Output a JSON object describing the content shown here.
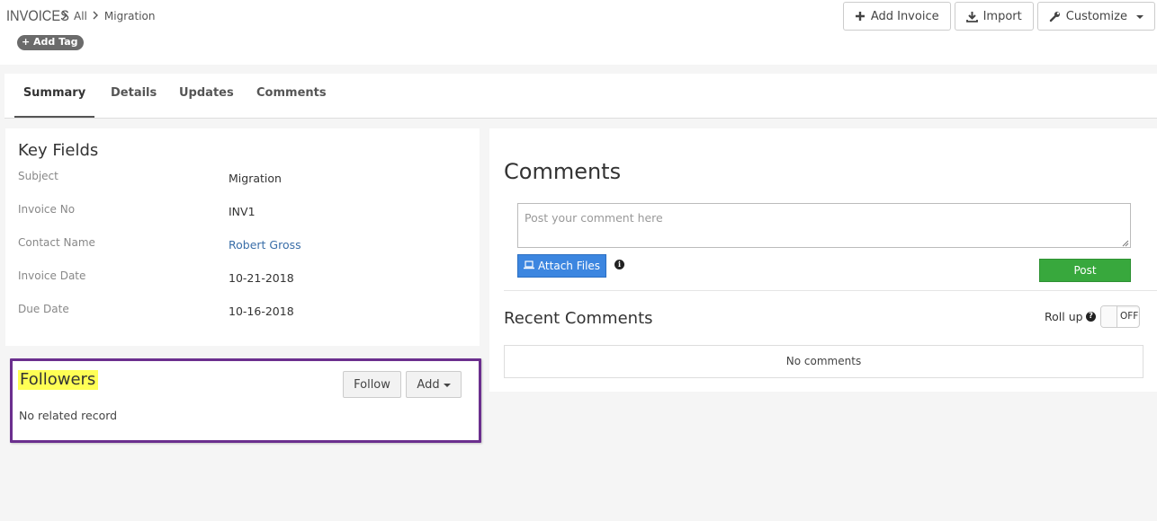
{
  "header": {
    "module": "INVOICES",
    "breadcrumb": [
      "All",
      "Migration"
    ],
    "add_tag_label": "+ Add Tag",
    "actions": {
      "add_invoice": "Add Invoice",
      "import": "Import",
      "customize": "Customize"
    }
  },
  "tabs": [
    {
      "label": "Summary",
      "active": true
    },
    {
      "label": "Details",
      "active": false
    },
    {
      "label": "Updates",
      "active": false
    },
    {
      "label": "Comments",
      "active": false
    }
  ],
  "key_fields": {
    "title": "Key Fields",
    "rows": [
      {
        "label": "Subject",
        "value": "Migration"
      },
      {
        "label": "Invoice No",
        "value": "INV1"
      },
      {
        "label": "Contact Name",
        "value": "Robert Gross"
      },
      {
        "label": "Invoice Date",
        "value": "10-21-2018"
      },
      {
        "label": "Due Date",
        "value": "10-16-2018"
      }
    ]
  },
  "followers": {
    "title": "Followers",
    "follow_label": "Follow",
    "add_label": "Add",
    "empty_text": "No related record"
  },
  "comments": {
    "title": "Comments",
    "placeholder": "Post your comment here",
    "attach_label": "Attach Files",
    "post_label": "Post",
    "recent_title": "Recent Comments",
    "rollup_label": "Roll up",
    "rollup_state": "OFF",
    "empty_text": "No comments"
  },
  "colors": {
    "accent_blue": "#3c86e0",
    "post_green": "#38a83d",
    "highlight_border": "#6b2f8e",
    "highlight_yellow": "#ffff55",
    "link": "#3a6ea8"
  },
  "icons": [
    "chevron-right-icon",
    "plus-icon",
    "download-icon",
    "wrench-icon",
    "caret-down-icon",
    "laptop-icon",
    "info-icon",
    "help-icon"
  ]
}
